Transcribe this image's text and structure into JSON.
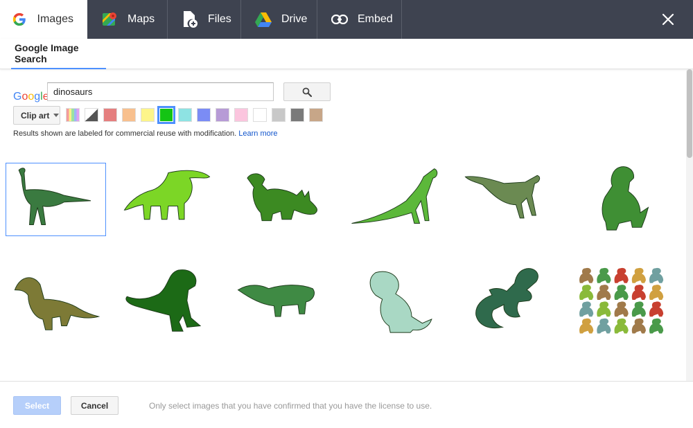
{
  "tabs": [
    {
      "label": "Images",
      "icon": "google-g-icon",
      "active": true
    },
    {
      "label": "Maps",
      "icon": "maps-pin-icon",
      "active": false
    },
    {
      "label": "Files",
      "icon": "file-add-icon",
      "active": false
    },
    {
      "label": "Drive",
      "icon": "drive-icon",
      "active": false
    },
    {
      "label": "Embed",
      "icon": "link-icon",
      "active": false
    }
  ],
  "subtab": {
    "label": "Google Image Search"
  },
  "search": {
    "logo": [
      "G",
      "o",
      "o",
      "g",
      "l",
      "e"
    ],
    "query": "dinosaurs",
    "placeholder": ""
  },
  "filters": {
    "type": "Clip art",
    "swatches": [
      "multicolor",
      "bw",
      "#e57f7f",
      "#f8c08e",
      "#fdf58a",
      "#14c414",
      "#8ee3e3",
      "#7b8cf5",
      "#b79bd6",
      "#fbc5de",
      "#ffffff",
      "#c8c8c8",
      "#7a7a7a",
      "#c7a688"
    ],
    "selected_swatch": 5
  },
  "notice": {
    "text": "Results shown are labeled for commercial reuse with modification.",
    "link": "Learn more"
  },
  "images": [
    {
      "icon": "dinosaur-image",
      "color": "#3a7a40",
      "selected": true
    },
    {
      "icon": "dinosaur-image",
      "color": "#7cd626",
      "selected": false
    },
    {
      "icon": "dinosaur-image",
      "color": "#3c8a22",
      "selected": false
    },
    {
      "icon": "dinosaur-image",
      "color": "#5cb83a",
      "selected": false
    },
    {
      "icon": "dinosaur-image",
      "color": "#6b8a52",
      "selected": false
    },
    {
      "icon": "dinosaur-image",
      "color": "#3f8f34",
      "selected": false
    },
    {
      "icon": "dinosaur-image",
      "color": "#7d7a36",
      "selected": false
    },
    {
      "icon": "dinosaur-image",
      "color": "#1c6a16",
      "selected": false
    },
    {
      "icon": "dinosaur-image",
      "color": "#3f8a44",
      "selected": false
    },
    {
      "icon": "dinosaur-image",
      "color": "#a9d8c4",
      "selected": false
    },
    {
      "icon": "lizard-image",
      "color": "#2f6a4c",
      "selected": false
    },
    {
      "icon": "dinosaur-pattern-image",
      "color": "#6a9a3a",
      "selected": false
    }
  ],
  "footer": {
    "select_label": "Select",
    "cancel_label": "Cancel",
    "license_text": "Only select images that you have confirmed that you have the license to use."
  },
  "colors": {
    "topbar": "#3e4350",
    "accent": "#4d90fe",
    "link": "#1155cc"
  }
}
